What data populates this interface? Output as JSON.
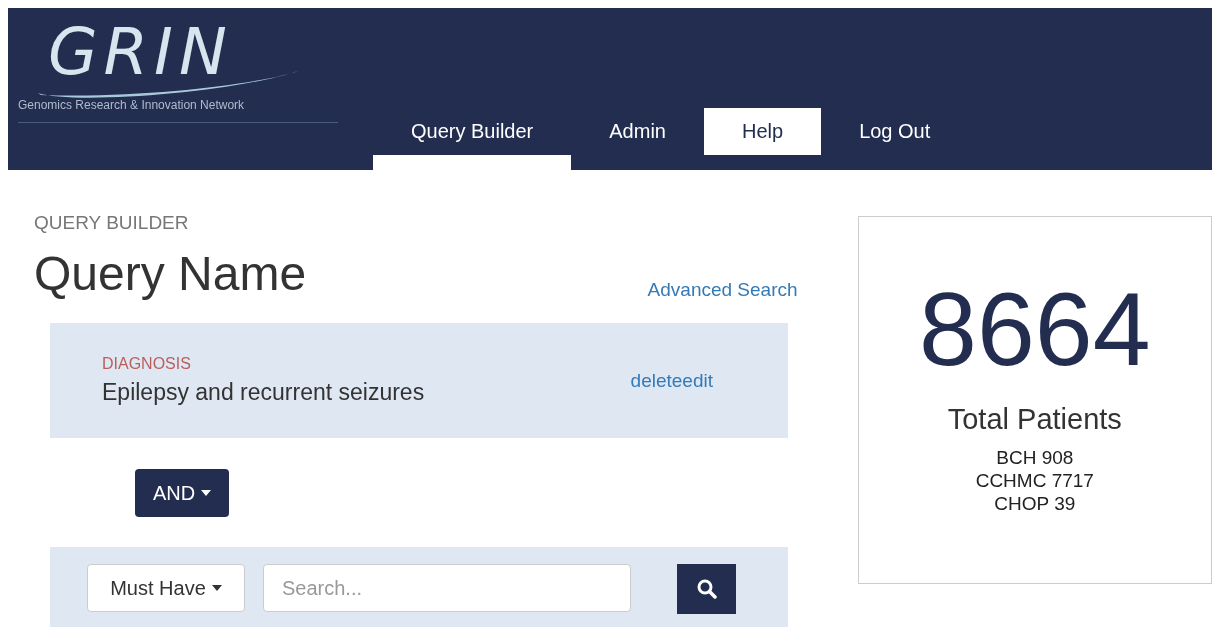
{
  "logo": {
    "title": "GRIN",
    "tagline": "Genomics Research & Innovation Network"
  },
  "nav": [
    {
      "label": "Query Builder",
      "selected": true,
      "highlighted": false
    },
    {
      "label": "Admin",
      "selected": false,
      "highlighted": false
    },
    {
      "label": "Help",
      "selected": false,
      "highlighted": true
    },
    {
      "label": "Log Out",
      "selected": false,
      "highlighted": false
    }
  ],
  "section": "QUERY BUILDER",
  "query_name": "Query Name",
  "advanced_search": "Advanced Search",
  "criteria": [
    {
      "category": "DIAGNOSIS",
      "value": "Epilepsy and recurrent seizures",
      "actions": "deleteedit"
    }
  ],
  "operator": "AND",
  "search": {
    "mode": "Must Have",
    "placeholder": "Search..."
  },
  "summary": {
    "count": "8664",
    "label": "Total Patients",
    "sites": [
      "BCH 908",
      "CCHMC 7717",
      "CHOP 39"
    ]
  }
}
